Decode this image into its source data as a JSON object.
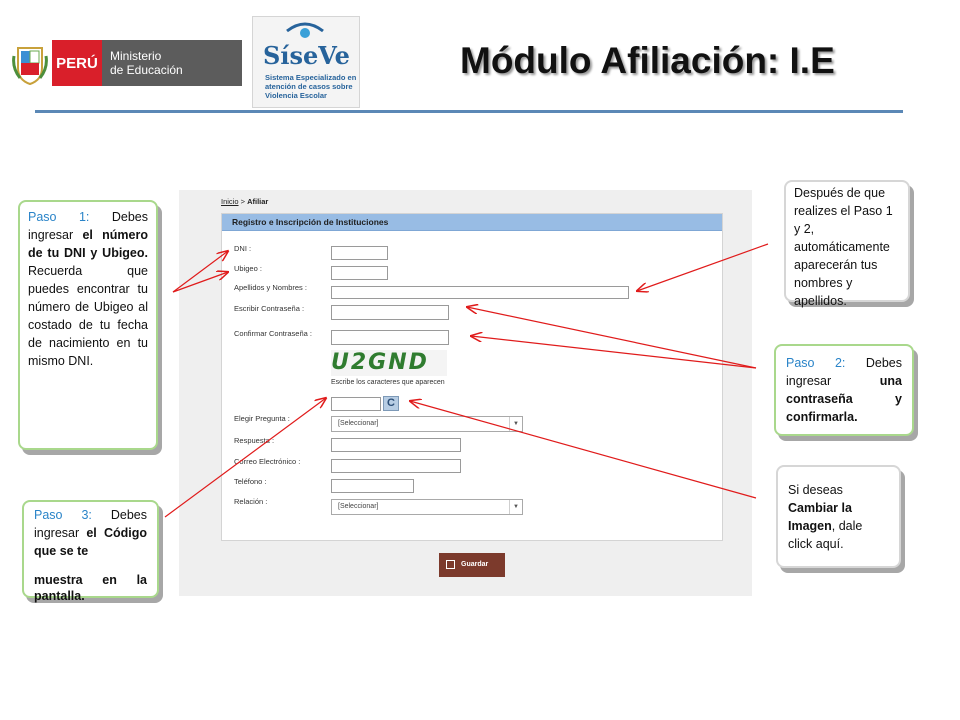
{
  "header": {
    "peru_label": "PERÚ",
    "ministry_line1": "Ministerio",
    "ministry_line2": "de Educación",
    "siseve_name": "SíseVe",
    "siseve_tagline": "Sistema Especializado en atención de casos sobre Violencia Escolar",
    "title": "Módulo Afiliación: I.E"
  },
  "breadcrumb": {
    "home": "Inicio",
    "separator": " > ",
    "current": "Afiliar"
  },
  "form": {
    "heading": "Registro e Inscripción de Instituciones",
    "labels": {
      "dni": "DNI  :",
      "ubigeo": "Ubigeo :",
      "nombres": "Apellidos  y  Nombres :",
      "password": "Escribir Contraseña :",
      "confirm": "Confirmar Contraseña :",
      "captcha_hint": "Escribe los caracteres que aparecen",
      "question": "Elegir Pregunta :",
      "answer": "Respuesta :",
      "email": "Correo Electrónico :",
      "phone": "Teléfono :",
      "relation": "Relación :"
    },
    "captcha_text": "U2GND",
    "refresh_symbol": "C",
    "select_placeholder": "[Seleccionar]",
    "save_label": "Guardar"
  },
  "callouts": {
    "step1": {
      "step": "Paso 1:",
      "t1": " Debes ingresar ",
      "b1": "el número de tu DNI y Ubigeo.",
      "t2": " Recuerda que puedes encontrar tu número de Ubigeo al costado de tu fecha de nacimiento en tu mismo DNI."
    },
    "names": "Después de que realizes el Paso 1 y 2, automáticamente aparecerán tus nombres y apellidos.",
    "step2": {
      "step": "Paso 2:",
      "t1": " Debes ingresar ",
      "b1": "una contraseña y confirmarla."
    },
    "step3": {
      "step": "Paso 3:",
      "t1": " Debes ingresar ",
      "b1": "el Código que se te",
      "b2": "muestra en la pantalla."
    },
    "image": {
      "t1": "Si deseas ",
      "b1": "Cambiar la Imagen",
      "t2": ", dale click aquí."
    }
  },
  "colors": {
    "arrow": "#e01b1b",
    "callout_border": "#a9d88c",
    "step_blue": "#2a84c8",
    "header_rule": "#5b88b6",
    "save_button": "#7c3a2c"
  }
}
